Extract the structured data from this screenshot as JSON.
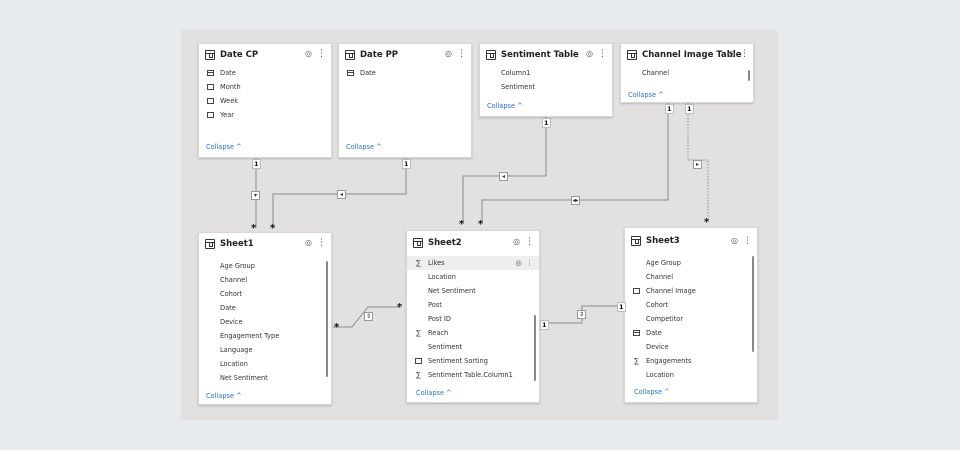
{
  "tables": {
    "date_cp": {
      "title": "Date CP",
      "fields": [
        "Date",
        "Month",
        "Week",
        "Year"
      ],
      "collapse": "Collapse ^"
    },
    "date_pp": {
      "title": "Date PP",
      "fields": [
        "Date"
      ],
      "collapse": "Collapse ^"
    },
    "sentiment_table": {
      "title": "Sentiment Table",
      "fields": [
        "Column1",
        "Sentiment"
      ],
      "collapse": "Collapse ^"
    },
    "channel_image_table": {
      "title": "Channel Image Table",
      "fields": [
        "Channel"
      ],
      "collapse": "Collapse ^"
    },
    "sheet1": {
      "title": "Sheet1",
      "fields": [
        "Age Group",
        "Channel",
        "Cohort",
        "Date",
        "Device",
        "Engagement Type",
        "Language",
        "Location",
        "Net Sentiment"
      ],
      "collapse": "Collapse ^"
    },
    "sheet2": {
      "title": "Sheet2",
      "fields": [
        "Likes",
        "Location",
        "Net Sentiment",
        "Post",
        "Post ID",
        "Reach",
        "Sentiment",
        "Sentiment Sorting",
        "Sentiment Table.Column1"
      ],
      "collapse": "Collapse ^"
    },
    "sheet3": {
      "title": "Sheet3",
      "fields": [
        "Age Group",
        "Channel",
        "Channel Image",
        "Cohort",
        "Competitor",
        "Date",
        "Device",
        "Engagements",
        "Location"
      ],
      "collapse": "Collapse ^"
    }
  },
  "cardinality": {
    "one": "1",
    "many": "*"
  },
  "icons": {
    "visibility": "eye-icon",
    "more": "more-options-icon",
    "table": "table-icon",
    "sum": "sigma-icon",
    "date": "calendar-icon",
    "hierarchy": "hierarchy-icon"
  },
  "colors": {
    "canvas": "#e3e1df",
    "page": "#e7ebee",
    "link": "#2a6fd6",
    "line": "#8a8a8a"
  }
}
